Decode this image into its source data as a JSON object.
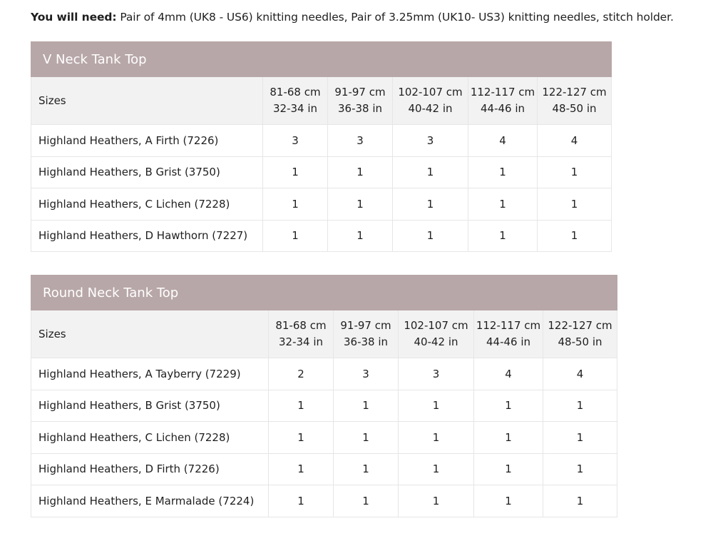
{
  "intro": {
    "label": "You will need:",
    "text": " Pair of 4mm (UK8 - US6) knitting needles, Pair of 3.25mm (UK10- US3) knitting needles, stitch holder."
  },
  "tables": [
    {
      "title": "V Neck Tank Top",
      "sizes_label": "Sizes",
      "sizes": [
        {
          "cm": "81-68 cm",
          "in": "32-34 in"
        },
        {
          "cm": "91-97 cm",
          "in": "36-38 in"
        },
        {
          "cm": "102-107 cm",
          "in": "40-42 in"
        },
        {
          "cm": "112-117 cm",
          "in": "44-46 in"
        },
        {
          "cm": "122-127 cm",
          "in": "48-50 in"
        }
      ],
      "rows": [
        {
          "label": "Highland Heathers, A Firth (7226)",
          "values": [
            "3",
            "3",
            "3",
            "4",
            "4"
          ]
        },
        {
          "label": "Highland Heathers, B Grist (3750)",
          "values": [
            "1",
            "1",
            "1",
            "1",
            "1"
          ]
        },
        {
          "label": "Highland Heathers, C Lichen (7228)",
          "values": [
            "1",
            "1",
            "1",
            "1",
            "1"
          ]
        },
        {
          "label": "Highland Heathers, D Hawthorn (7227)",
          "values": [
            "1",
            "1",
            "1",
            "1",
            "1"
          ]
        }
      ]
    },
    {
      "title": "Round Neck Tank Top",
      "sizes_label": "Sizes",
      "sizes": [
        {
          "cm": "81-68 cm",
          "in": "32-34 in"
        },
        {
          "cm": "91-97 cm",
          "in": "36-38 in"
        },
        {
          "cm": "102-107 cm",
          "in": "40-42 in"
        },
        {
          "cm": "112-117 cm",
          "in": "44-46 in"
        },
        {
          "cm": "122-127 cm",
          "in": "48-50 in"
        }
      ],
      "rows": [
        {
          "label": "Highland Heathers, A Tayberry (7229)",
          "values": [
            "2",
            "3",
            "3",
            "4",
            "4"
          ]
        },
        {
          "label": "Highland Heathers, B Grist (3750)",
          "values": [
            "1",
            "1",
            "1",
            "1",
            "1"
          ]
        },
        {
          "label": "Highland Heathers, C Lichen (7228)",
          "values": [
            "1",
            "1",
            "1",
            "1",
            "1"
          ]
        },
        {
          "label": "Highland Heathers, D Firth (7226)",
          "values": [
            "1",
            "1",
            "1",
            "1",
            "1"
          ]
        },
        {
          "label": "Highland Heathers, E Marmalade (7224)",
          "values": [
            "1",
            "1",
            "1",
            "1",
            "1"
          ]
        }
      ]
    }
  ],
  "colors": {
    "header_band": "#b8a7a8",
    "sizes_row_bg": "#f2f2f2",
    "border": "#e6e6e6"
  }
}
